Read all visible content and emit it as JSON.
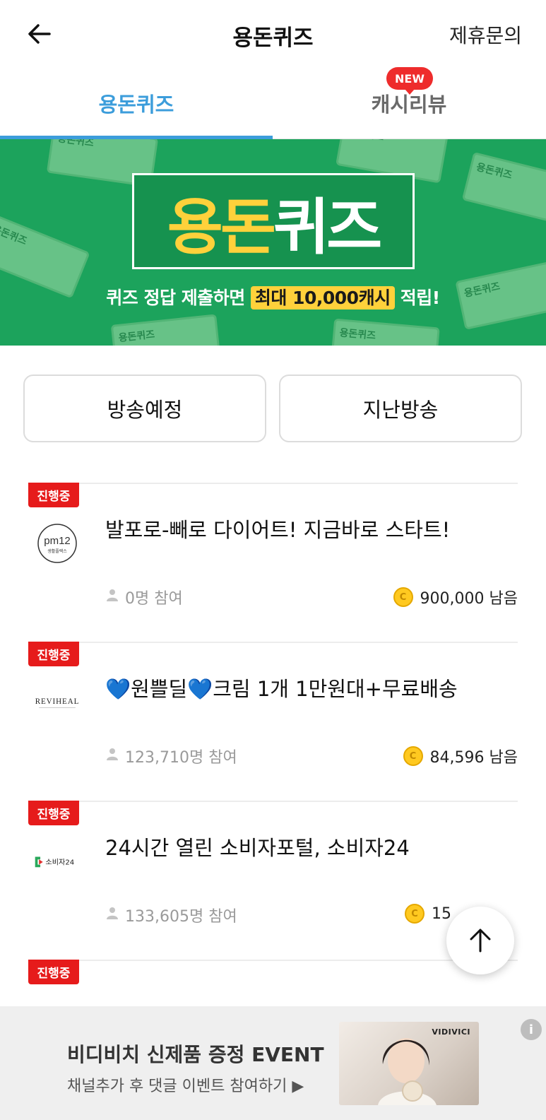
{
  "header": {
    "title": "용돈퀴즈",
    "partner_label": "제휴문의"
  },
  "tabs": [
    {
      "label": "용돈퀴즈",
      "active": true
    },
    {
      "label": "캐시리뷰",
      "active": false,
      "badge": "NEW"
    }
  ],
  "banner": {
    "title_part1": "용돈",
    "title_part2": "퀴즈",
    "subtitle_prefix": "퀴즈 정답 제출하면 ",
    "subtitle_highlight": "최대 10,000캐시",
    "subtitle_suffix": " 적립!",
    "bill_text": "용돈퀴즈"
  },
  "segments": [
    "방송예정",
    "지난방송"
  ],
  "quiz_list": [
    {
      "status": "진행중",
      "brand": "pm12",
      "brand_sub": "생활플렉스",
      "title": "발포로-빼로 다이어트! 지금바로 스타트!",
      "participants": "0명 참여",
      "remaining": "900,000 남음"
    },
    {
      "status": "진행중",
      "brand": "REVIHEAL",
      "title": "💙원쁠딜💙크림 1개 1만원대+무료배송",
      "participants": "123,710명 참여",
      "remaining": "84,596 남음"
    },
    {
      "status": "진행중",
      "brand": "소비자24",
      "title": "24시간 열린 소비자포털, 소비자24",
      "participants": "133,605명 참여",
      "remaining": "15"
    },
    {
      "status": "진행중"
    }
  ],
  "ad": {
    "title": "비디비치 신제품 증정 EVENT",
    "subtitle": "채널추가 후 댓글 이벤트 참여하기 ▶",
    "image_brand": "VIDIVICI"
  },
  "colors": {
    "accent": "#3c9ddb",
    "badge_red": "#e61b1b",
    "banner_green": "#1ca35c",
    "banner_yellow": "#ffd13b"
  }
}
